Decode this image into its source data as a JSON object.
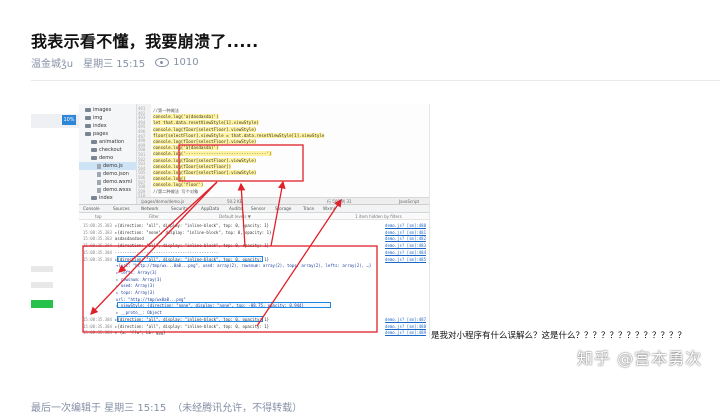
{
  "article": {
    "title": "我表示看不懂，我要崩溃了.....",
    "author": "温金城ʒ̃u",
    "date": "星期三 15:15",
    "views": "1010",
    "question": "是我对小程序有什么误解么？这是什么？？？？？？？？？？？？？",
    "footer_edited": "最后一次编辑于  星期三 15:15",
    "footer_license": "（未经腾讯允许，不得转载）"
  },
  "watermark": "知乎 @宫本勇次",
  "screenshot": {
    "phone_pct": "10%",
    "tree": [
      "images",
      "img",
      "index",
      "pages",
      "animation",
      "checkout",
      "demo",
      "demo.js",
      "demo.json",
      "demo.wxml",
      "demo.wxss",
      "index"
    ],
    "line_numbers": [
      "491",
      "492",
      "493",
      "494",
      "495",
      "496",
      "497",
      "498",
      "499",
      "500",
      "501",
      "502",
      "503",
      "504",
      "505",
      "506",
      "507",
      "508",
      "509",
      "510"
    ],
    "code": [
      "//第一种做法",
      "console.log('a(dasdasda)')",
      "let that.data.resetViewStyle[1].viewStyle)",
      "console.log(fIoor[selectFloor].viewStyle)",
      "floor[selectFloor].viewStyle = that.data.resetViewStyle[1].viewStyle",
      "console.log(fIoor[selectFloor].viewStyle)",
      "console.log('a(dasdasda)')",
      "console.log('--------------------------------')",
      "console.log(fIoor[selectFloor].viewStyle)",
      "console.log(fIoor[selectFloor])",
      "console.log(fIoor[selectFloor].viewStyle)",
      "console.log()",
      "console.log('floor')",
      "//第二种做法 写个对象"
    ],
    "editor_status": [
      "/pages/demo/demo.js",
      "50.2 KB",
      "行 508 列 31",
      "JavaScript"
    ],
    "dt_tabs": [
      "Console",
      "Sources",
      "Network",
      "Security",
      "AppData",
      "Audits",
      "Sensor",
      "Storage",
      "Trace",
      "Wxml"
    ],
    "dt_filter": [
      "top",
      "Filter",
      "Default levels ▼",
      "1 item hidden by filters"
    ],
    "console": [
      {
        "t": "15:08:35.383",
        "text": "▸{direction: \"all\", display: \"inline-block\", top: 0, opacity: 1}",
        "src": "demo.js? [sm]:480"
      },
      {
        "t": "15:08:35.383",
        "text": "▸{direction: \"none\", display: \"inline-block\", top: 0, opacity: 1}",
        "src": "demo.js? [sm]:481"
      },
      {
        "t": "15:08:35.383",
        "text": "asdasdasdasd",
        "src": "demo.js? [sm]:482"
      },
      {
        "t": "15:08:35.384",
        "text": "▸{direction: \"all\", display: \"inline-block\", top: 0, opacity: 1}",
        "src": "demo.js? [sm]:483"
      },
      {
        "t": "15:08:35.384",
        "text": "-------------------------------------------",
        "src": "demo.js? [sm]:484"
      },
      {
        "t": "15:08:35.384",
        "text": "▸{direction: \"all\", display: \"inline-block\", top: 0, opacity: 1}",
        "src": "demo.js? [sm]:485"
      },
      {
        "t": "",
        "text": "▾{url: \"http://tmp/wx...0a0...png\", used: array(2), rowsnum: array(2), tops: array(2), lefts: array(2), …}",
        "src": ""
      },
      {
        "t": "",
        "text": "  ▸ lefts: Array(3)",
        "src": ""
      },
      {
        "t": "",
        "text": "  ▸ rowsnum: Array(3)",
        "src": ""
      },
      {
        "t": "",
        "text": "  ▸ used: Array(3)",
        "src": ""
      },
      {
        "t": "",
        "text": "  ▸ tops: Array(3)",
        "src": ""
      },
      {
        "t": "",
        "text": "    url: \"http://tmp/wx0a0...png\"",
        "src": ""
      },
      {
        "t": "",
        "text": "  ▸ viewStyle: {direction: \"none\", display: \"none\", top: -88.75, opacity: 0.944}",
        "src": ""
      },
      {
        "t": "",
        "text": "  ▸ __proto__: Object",
        "src": ""
      },
      {
        "t": "15:08:35.384",
        "text": "▸{direction: \"all\", display: \"inline-block\", top: 0, opacity: 1}",
        "src": "demo.js? [sm]:487"
      },
      {
        "t": "15:08:35.384",
        "text": "▸{direction: \"all\", display: \"inline-block\", top: 0, opacity: 1}",
        "src": "demo.js? [sm]:488"
      },
      {
        "t": "15:08:35.384",
        "text": "▸ {a: 'ffa', bb: ggg}",
        "src": "demo.js? [sm]:489"
      }
    ]
  },
  "colors": {
    "annotation_red": "#e0202a",
    "highlight_blue": "#1e88e5",
    "meta_grey": "#8590a6",
    "green_button": "#27c24c"
  },
  "icons": {
    "views": "eye-icon",
    "folder": "folder-icon",
    "file": "file-icon"
  }
}
